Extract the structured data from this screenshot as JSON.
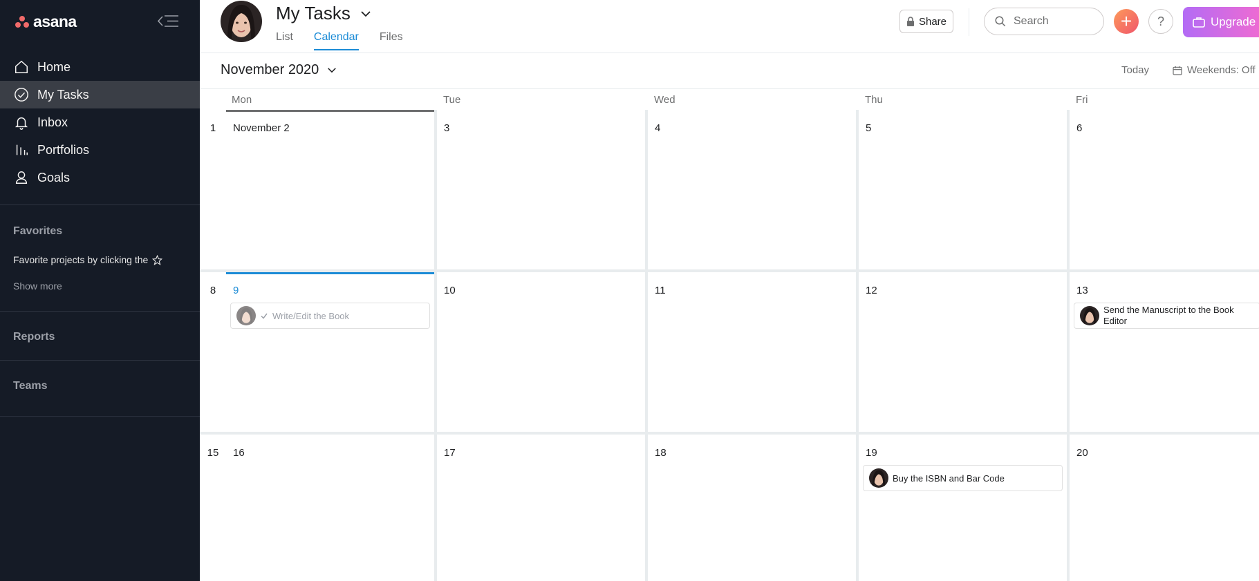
{
  "brand": {
    "name": "asana",
    "logo_color": "#f06a6a"
  },
  "sidebar": {
    "items": [
      {
        "label": "Home",
        "icon": "home-icon",
        "active": false
      },
      {
        "label": "My Tasks",
        "icon": "check-circle-icon",
        "active": true
      },
      {
        "label": "Inbox",
        "icon": "bell-icon",
        "active": false
      },
      {
        "label": "Portfolios",
        "icon": "bar-chart-icon",
        "active": false
      },
      {
        "label": "Goals",
        "icon": "person-icon",
        "active": false
      }
    ],
    "favorites_title": "Favorites",
    "favorites_hint": "Favorite projects by clicking the",
    "show_more": "Show more",
    "reports_title": "Reports",
    "teams_title": "Teams"
  },
  "header": {
    "title": "My Tasks",
    "tabs": [
      {
        "label": "List",
        "active": false
      },
      {
        "label": "Calendar",
        "active": true
      },
      {
        "label": "Files",
        "active": false
      }
    ],
    "share_label": "Share",
    "search_placeholder": "Search",
    "plus_label": "+",
    "help_label": "?",
    "upgrade_label": "Upgrade"
  },
  "calendar": {
    "month_label": "November 2020",
    "today_label": "Today",
    "weekends_label": "Weekends: Off",
    "weekdays": [
      "Mon",
      "Tue",
      "Wed",
      "Thu",
      "Fri"
    ],
    "weeks": [
      {
        "week_number": "1",
        "days": [
          "November 2",
          "3",
          "4",
          "5",
          "6"
        ]
      },
      {
        "week_number": "8",
        "days": [
          "9",
          "10",
          "11",
          "12",
          "13"
        ]
      },
      {
        "week_number": "15",
        "days": [
          "16",
          "17",
          "18",
          "19",
          "20"
        ]
      }
    ],
    "tasks": [
      {
        "title": "Write/Edit the Book",
        "completed": true,
        "day": "9"
      },
      {
        "title": "Send the Manuscript to the Book Editor",
        "completed": false,
        "day": "13"
      },
      {
        "title": "Buy the ISBN and Bar Code",
        "completed": false,
        "day": "19"
      }
    ]
  },
  "colors": {
    "sidebar_bg": "#151b26",
    "accent_blue": "#1b8bd6",
    "active_item_bg": "#3a3e46"
  }
}
